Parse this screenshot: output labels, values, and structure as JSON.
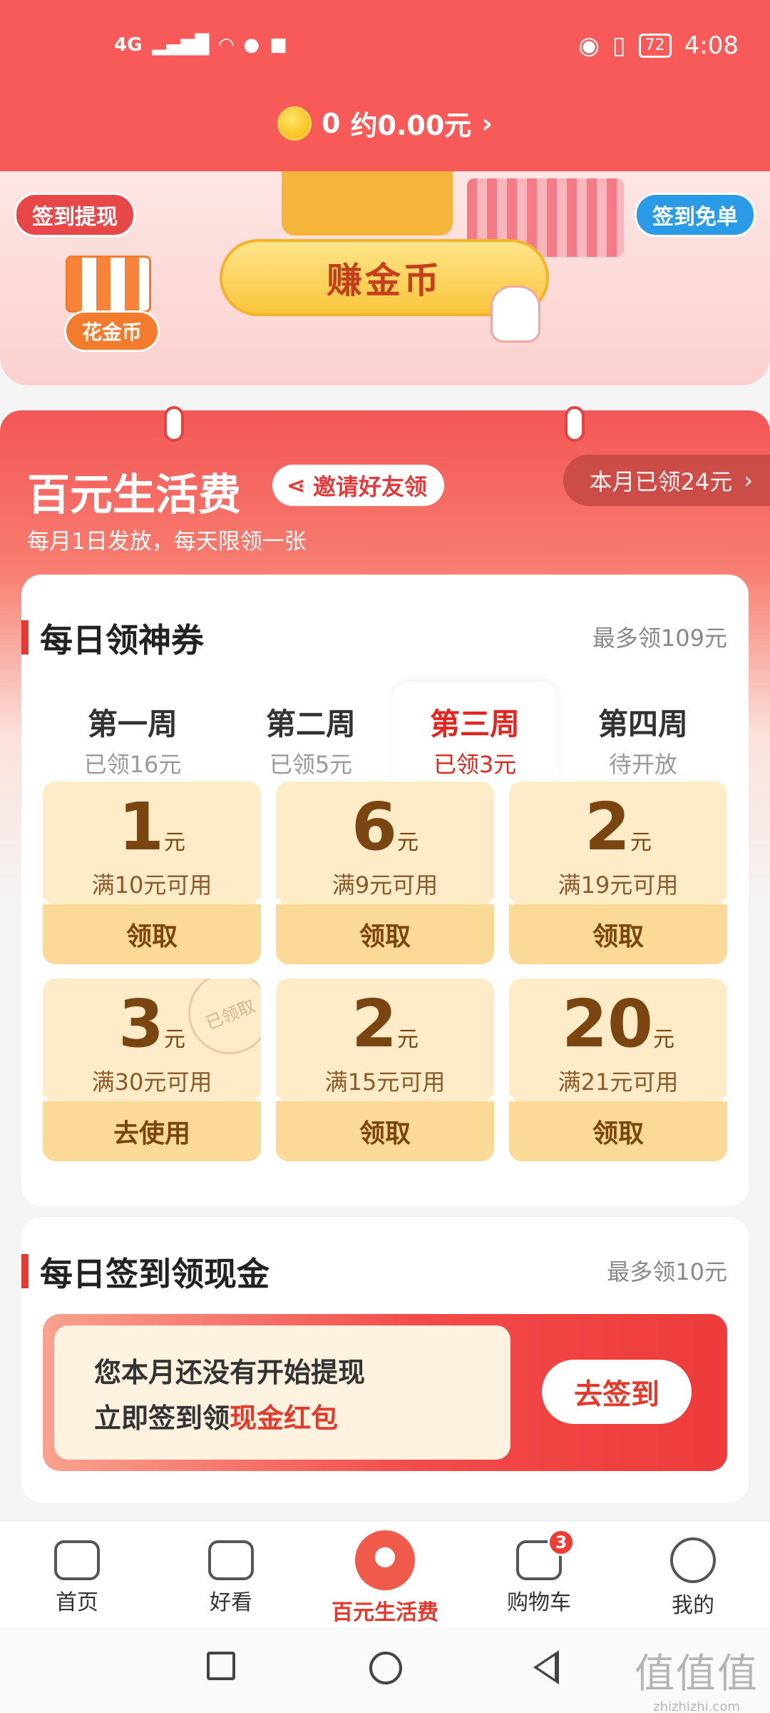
{
  "status": {
    "network": "4G",
    "battery": "72",
    "time": "4:08"
  },
  "header": {
    "coins": "0",
    "coins_approx": "约0.00元",
    "chevron": "›"
  },
  "banner": {
    "withdraw_tag": "签到提现",
    "free_tag": "签到免单",
    "flower_tag": "花金币",
    "earn_button": "赚金币"
  },
  "main": {
    "title": "百元生活费",
    "invite_label": "邀请好友领",
    "monthly_label": "本月已领24元",
    "monthly_chevron": "›",
    "subtitle": "每月1日发放，每天限领一张",
    "coupons_section": {
      "title": "每日领神券",
      "max": "最多领109元",
      "weeks": [
        {
          "name": "第一周",
          "status": "已领16元"
        },
        {
          "name": "第二周",
          "status": "已领5元"
        },
        {
          "name": "第三周",
          "status": "已领3元"
        },
        {
          "name": "第四周",
          "status": "待开放"
        }
      ],
      "coupons": [
        {
          "value": "1",
          "unit": "元",
          "condition": "满10元可用",
          "action": "领取"
        },
        {
          "value": "6",
          "unit": "元",
          "condition": "满9元可用",
          "action": "领取"
        },
        {
          "value": "2",
          "unit": "元",
          "condition": "满19元可用",
          "action": "领取"
        },
        {
          "value": "3",
          "unit": "元",
          "condition": "满30元可用",
          "action": "去使用",
          "stamp": "已领取"
        },
        {
          "value": "2",
          "unit": "元",
          "condition": "满15元可用",
          "action": "领取"
        },
        {
          "value": "20",
          "unit": "元",
          "condition": "满21元可用",
          "action": "领取"
        }
      ]
    },
    "checkin_section": {
      "title": "每日签到领现金",
      "max": "最多领10元",
      "line1": "您本月还没有开始提现",
      "line2_prefix": "立即签到领",
      "line2_highlight": "现金红包",
      "button": "去签到"
    }
  },
  "bottom_nav": [
    {
      "label": "首页",
      "icon": "home-icon"
    },
    {
      "label": "好看",
      "icon": "video-icon"
    },
    {
      "label": "百元生活费",
      "icon": "red-envelope-icon"
    },
    {
      "label": "购物车",
      "icon": "cart-icon",
      "badge": "3"
    },
    {
      "label": "我的",
      "icon": "profile-icon"
    }
  ],
  "watermark": {
    "text": "值值值",
    "url": "zhizhizhi.com"
  },
  "colors": {
    "header_red": "#f75a59",
    "accent_red": "#e2261f",
    "coupon_bg": "#fdecc7",
    "coupon_action_bg": "#fbd996"
  }
}
